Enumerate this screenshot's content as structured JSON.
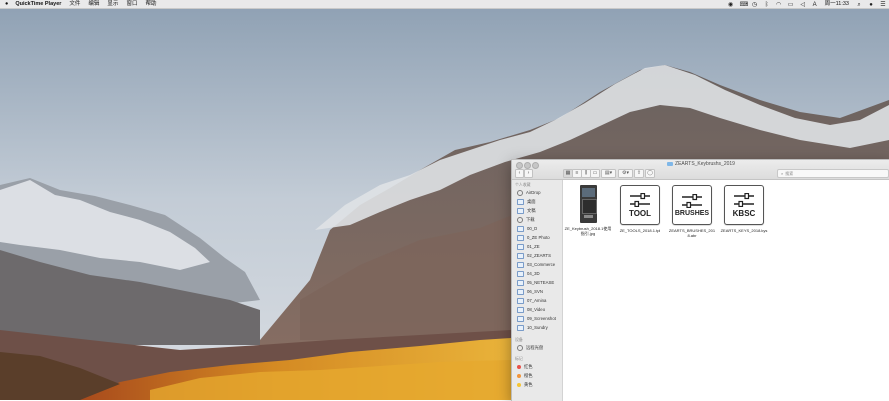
{
  "menubar": {
    "app_name": "QuickTime Player",
    "menus": [
      "文件",
      "编辑",
      "显示",
      "窗口",
      "帮助"
    ],
    "clock": "周一11:33"
  },
  "finder": {
    "title": "ZEARTS_Keybrushs_2019",
    "search_placeholder": "搜索",
    "sidebar": {
      "favorites_header": "个人收藏",
      "favorites": [
        "AirDrop",
        "桌面",
        "文稿",
        "下载",
        "00_D",
        "0_ZE Photo",
        "01_ZE",
        "02_ZEARTS",
        "03_Commerce",
        "04_3D",
        "05_NETEASE",
        "06_SVN",
        "07_Amina",
        "08_Video",
        "09_Screenshot",
        "10_Sundry"
      ],
      "devices_header": "设备",
      "devices": [
        "远程光盘"
      ],
      "tags_header": "标记",
      "tags": [
        {
          "label": "红色",
          "color": "#e8514a"
        },
        {
          "label": "橙色",
          "color": "#f2953b"
        },
        {
          "label": "黄色",
          "color": "#f5c534"
        }
      ]
    },
    "files": [
      {
        "name": "ZE_Keybrush_2018.1使用指引.jpg",
        "kind": "image"
      },
      {
        "name": "ZE_TOOLS_2018.1.tpl",
        "kind": "doc",
        "icon_text": "TOOL"
      },
      {
        "name": "ZEARTS_BRUSHES_2018.abr",
        "kind": "doc",
        "icon_text": "BRUSHES"
      },
      {
        "name": "ZEARTS_KEYS_2018.kys",
        "kind": "doc",
        "icon_text": "KBSC"
      }
    ]
  }
}
